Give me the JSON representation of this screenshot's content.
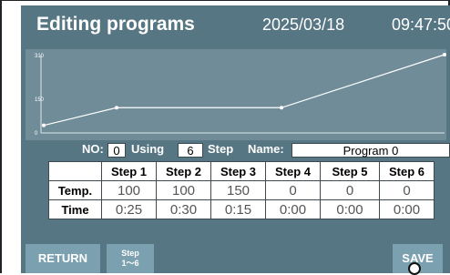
{
  "header": {
    "title": "Editing programs",
    "date": "2025/03/18",
    "time": "09:47:50"
  },
  "graph": {
    "y_ticks": [
      "310",
      "150",
      "0"
    ],
    "temperature_profile": [
      30,
      100,
      100,
      310
    ],
    "y_max": 310
  },
  "info": {
    "no_label": "NO:",
    "no_value": "0",
    "using_label": "Using",
    "using_value": "6",
    "step_label": "Step",
    "name_label": "Name:",
    "name_value": "Program 0"
  },
  "table": {
    "headers": [
      "Step 1",
      "Step 2",
      "Step 3",
      "Step 4",
      "Step 5",
      "Step 6"
    ],
    "temp_label": "Temp.",
    "temp_values": [
      "100",
      "100",
      "150",
      "0",
      "0",
      "0"
    ],
    "time_label": "Time",
    "time_values": [
      "0:25",
      "0:30",
      "0:15",
      "0:00",
      "0:00",
      "0:00"
    ]
  },
  "buttons": {
    "return_label": "RETURN",
    "step_line1": "Step",
    "step_line2": "1～6",
    "save_label": "SAVE"
  },
  "colors": {
    "screen_bg": "#577683",
    "graph_bg": "#6f8c98",
    "button_bg": "#7ba1b0"
  }
}
